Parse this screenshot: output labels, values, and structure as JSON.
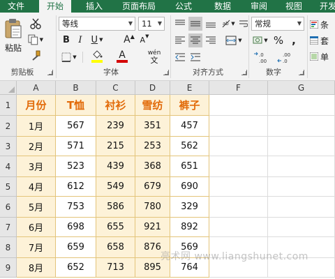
{
  "tabs": [
    "文件",
    "开始",
    "插入",
    "页面布局",
    "公式",
    "数据",
    "审阅",
    "视图",
    "开发"
  ],
  "active_tab": "开始",
  "ribbon": {
    "clipboard": {
      "paste_label": "粘贴",
      "group_label": "剪贴板"
    },
    "font": {
      "font_name": "等线",
      "font_size": "11",
      "phonetic_label": "wén",
      "group_label": "字体",
      "bold": "B",
      "italic": "I",
      "underline": "U",
      "grow": "A",
      "shrink": "A",
      "fill_letter": "A"
    },
    "alignment": {
      "group_label": "对齐方式"
    },
    "number": {
      "format": "常规",
      "group_label": "数字",
      "percent": "%",
      "comma": ","
    },
    "styles": {
      "items": [
        "条",
        "套",
        "单"
      ]
    }
  },
  "columns": [
    "A",
    "B",
    "C",
    "D",
    "E",
    "F",
    "G"
  ],
  "rows": [
    "1",
    "2",
    "3",
    "4",
    "5",
    "6",
    "7",
    "8",
    "9"
  ],
  "table": {
    "headers": [
      "月份",
      "T恤",
      "衬衫",
      "雪纺",
      "裤子"
    ],
    "data": [
      [
        "1月",
        "567",
        "239",
        "351",
        "457"
      ],
      [
        "2月",
        "571",
        "215",
        "253",
        "562"
      ],
      [
        "3月",
        "523",
        "439",
        "368",
        "651"
      ],
      [
        "4月",
        "612",
        "549",
        "679",
        "690"
      ],
      [
        "5月",
        "753",
        "586",
        "780",
        "329"
      ],
      [
        "6月",
        "698",
        "655",
        "921",
        "892"
      ],
      [
        "7月",
        "659",
        "658",
        "876",
        "569"
      ],
      [
        "8月",
        "652",
        "713",
        "895",
        "764"
      ]
    ]
  },
  "watermark": "亮术网 www.liangshunet.com",
  "colors": {
    "ribbon_green": "#217346",
    "header_orange": "#e26b0a",
    "cell_fill": "#fdf2d8",
    "cell_fill_white": "#ffffff",
    "border_gold": "#e3c47a",
    "font_red": "#d40000",
    "fill_yellow": "#ffff00"
  }
}
